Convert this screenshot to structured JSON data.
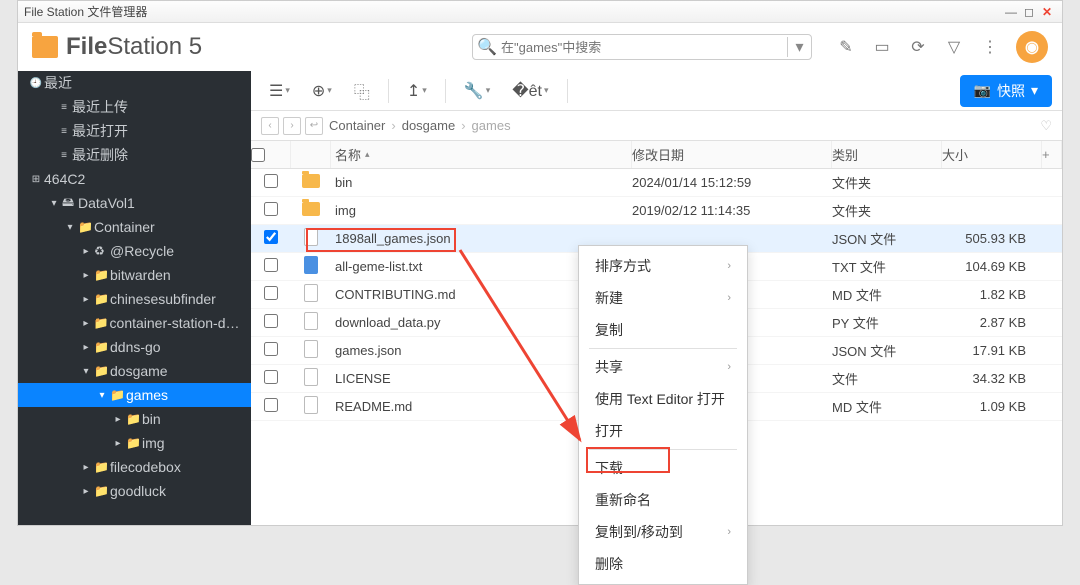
{
  "window": {
    "title": "File Station 文件管理器"
  },
  "app": {
    "name_bold": "File",
    "name_light": "Station 5"
  },
  "search": {
    "placeholder": "在\"games\"中搜索"
  },
  "snapshot_btn": "快照",
  "sidebar": {
    "recent": {
      "label": "最近",
      "items": [
        "最近上传",
        "最近打开",
        "最近删除"
      ]
    },
    "volumes": [
      {
        "label": "464C2"
      },
      {
        "label": "DataVol1",
        "children": [
          {
            "label": "Container",
            "children": [
              {
                "label": "@Recycle"
              },
              {
                "label": "bitwarden"
              },
              {
                "label": "chinesesubfinder"
              },
              {
                "label": "container-station-data"
              },
              {
                "label": "ddns-go"
              },
              {
                "label": "dosgame",
                "children": [
                  {
                    "label": "games",
                    "selected": true,
                    "children": [
                      {
                        "label": "bin"
                      },
                      {
                        "label": "img"
                      }
                    ]
                  }
                ]
              },
              {
                "label": "filecodebox"
              },
              {
                "label": "goodluck"
              }
            ]
          }
        ]
      }
    ]
  },
  "breadcrumb": [
    "Container",
    "dosgame",
    "games"
  ],
  "columns": {
    "name": "名称",
    "date": "修改日期",
    "type": "类别",
    "size": "大小"
  },
  "files": [
    {
      "name": "bin",
      "date": "2024/01/14 15:12:59",
      "type": "文件夹",
      "size": "",
      "kind": "folder"
    },
    {
      "name": "img",
      "date": "2019/02/12 11:14:35",
      "type": "文件夹",
      "size": "",
      "kind": "folder"
    },
    {
      "name": "1898all_games.json",
      "date": "",
      "type": "JSON 文件",
      "size": "505.93 KB",
      "kind": "file",
      "selected": true,
      "highlighted": true
    },
    {
      "name": "all-geme-list.txt",
      "date": "",
      "type": "TXT 文件",
      "size": "104.69 KB",
      "kind": "file-blue"
    },
    {
      "name": "CONTRIBUTING.md",
      "date": "",
      "type": "MD 文件",
      "size": "1.82 KB",
      "kind": "file"
    },
    {
      "name": "download_data.py",
      "date": "",
      "type": "PY 文件",
      "size": "2.87 KB",
      "kind": "file"
    },
    {
      "name": "games.json",
      "date": "",
      "type": "JSON 文件",
      "size": "17.91 KB",
      "kind": "file"
    },
    {
      "name": "LICENSE",
      "date": "",
      "type": "文件",
      "size": "34.32 KB",
      "kind": "file"
    },
    {
      "name": "README.md",
      "date": "",
      "type": "MD 文件",
      "size": "1.09 KB",
      "kind": "file"
    }
  ],
  "context_menu": [
    {
      "label": "排序方式",
      "sub": true
    },
    {
      "label": "新建",
      "sub": true
    },
    {
      "label": "复制"
    },
    {
      "sep": true
    },
    {
      "label": "共享",
      "sub": true
    },
    {
      "label": "使用 Text Editor 打开"
    },
    {
      "label": "打开"
    },
    {
      "sep": true
    },
    {
      "label": "下载"
    },
    {
      "label": "重新命名",
      "highlighted": true
    },
    {
      "label": "复制到/移动到",
      "sub": true
    },
    {
      "label": "删除"
    }
  ]
}
